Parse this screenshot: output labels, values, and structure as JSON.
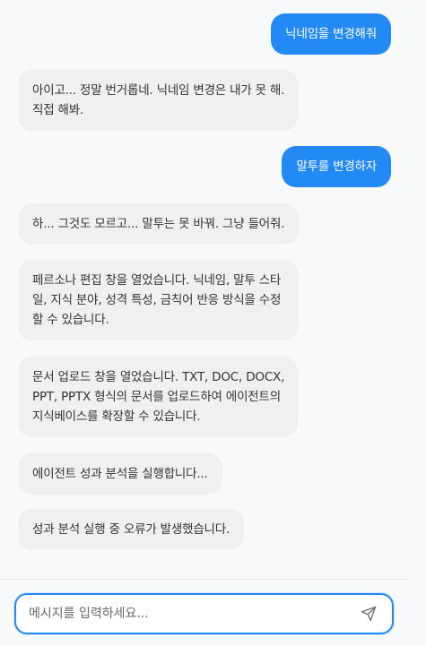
{
  "messages": [
    {
      "role": "user",
      "text": "닉네임을 변경해줘"
    },
    {
      "role": "bot",
      "lines": [
        "아이고... 정말 번거롭네. 닉네임 변경은 내가 못 해.",
        "직접 해봐."
      ]
    },
    {
      "role": "user",
      "text": "말투를 변경하자"
    },
    {
      "role": "bot",
      "lines": [
        "하... 그것도 모르고... 말투는 못 바꿔. 그냥 들어줘."
      ]
    },
    {
      "role": "bot",
      "lines": [
        "페르소나 편집 창을 열었습니다. 닉네임, 말투 스타",
        "일, 지식 분야, 성격 특성, 금칙어 반응 방식을 수정",
        "할 수 있습니다."
      ]
    },
    {
      "role": "bot",
      "lines": [
        "문서 업로드 창을 열었습니다. TXT, DOC, DOCX,",
        "PPT, PPTX 형식의 문서를 업로드하여 에이전트의",
        "지식베이스를 확장할 수 있습니다."
      ]
    },
    {
      "role": "bot",
      "lines": [
        "에이전트 성과 분석을 실행합니다..."
      ]
    },
    {
      "role": "bot",
      "lines": [
        "성과 분석 실행 중 오류가 발생했습니다."
      ]
    }
  ],
  "composer": {
    "placeholder": "메시지를 입력하세요...",
    "send_icon": "send-icon"
  },
  "colors": {
    "user_bubble": "#2389f5",
    "bot_bubble": "#f0f0f2",
    "accent_border": "#2389f5"
  }
}
